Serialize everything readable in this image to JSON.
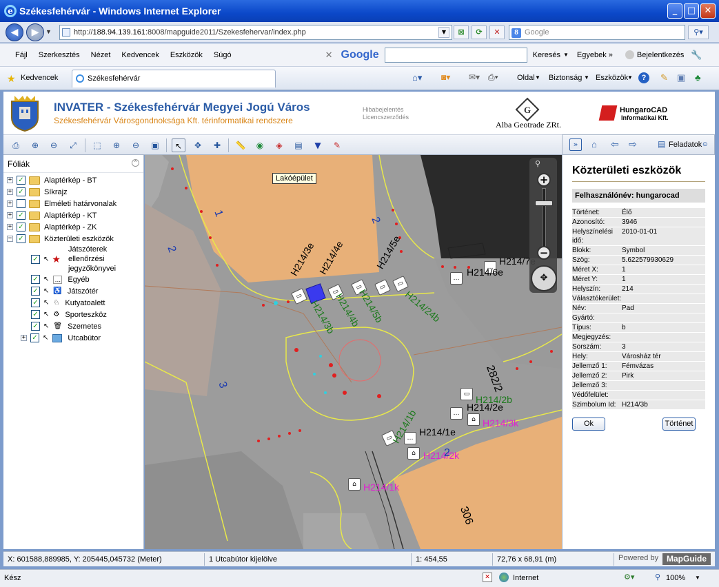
{
  "window": {
    "title": "Székesfehérvár - Windows Internet Explorer",
    "minimize": "_",
    "maximize": "□",
    "close": "✕"
  },
  "address": {
    "url_prefix": "http://",
    "host": "188.94.139.161",
    "url_rest": ":8008/mapguide2011/Szekesfehervar/index.php",
    "search_placeholder": "Google"
  },
  "menubar": {
    "items": [
      "Fájl",
      "Szerkesztés",
      "Nézet",
      "Kedvencek",
      "Eszközök",
      "Súgó"
    ],
    "google_logo": "Google",
    "search_button": "Keresés",
    "more": "Egyebek »",
    "signin": "Bejelentkezés"
  },
  "favbar": {
    "favorites": "Kedvencek",
    "tab_title": "Székesfehérvár",
    "page": "Oldal",
    "security": "Biztonság",
    "tools": "Eszközök"
  },
  "app": {
    "title": "INVATER - Székesfehérvár Megyei Jogú Város",
    "subtitle": "Székesfehérvár Városgondnoksága Kft. térinformatikai rendszere",
    "link1": "Hibabejelentés",
    "link2": "Licencszerződés",
    "partner1": "Alba Geotrade ZRt.",
    "partner2_line1": "HungaroCAD",
    "partner2_line2": "Informatikai Kft."
  },
  "taskbar": {
    "tasks_label": "Feladatok"
  },
  "legend": {
    "title": "Fóliák",
    "layers": [
      {
        "label": "Alaptérkép - BT",
        "checked": true
      },
      {
        "label": "Síkrajz",
        "checked": true
      },
      {
        "label": "Elméleti határvonalak",
        "checked": false
      },
      {
        "label": "Alaptérkép - KT",
        "checked": true
      },
      {
        "label": "Alaptérkép - ZK",
        "checked": true
      },
      {
        "label": "Közterületi eszközök",
        "checked": true
      }
    ],
    "sublayers": [
      {
        "label_line1": "Játszóterek",
        "label_line2": "ellenőrzési",
        "label_line3": "jegyzőkönyvei"
      },
      {
        "label": "Egyéb"
      },
      {
        "label": "Játszótér"
      },
      {
        "label": "Kutyatoalett"
      },
      {
        "label": "Sporteszköz"
      },
      {
        "label": "Szemetes"
      },
      {
        "label": "Utcabútor"
      }
    ]
  },
  "map": {
    "tooltip": "Lakóépület",
    "labels": [
      "H214/3e",
      "H214/4e",
      "H214/5e",
      "H214/6e",
      "H214/7e",
      "H214/3b",
      "H214/4b",
      "H214/5b",
      "H214/24b",
      "H214/1b",
      "H214/1e",
      "H214/2e",
      "H214/2b",
      "H214/3k",
      "H214/2k",
      "H214/1k",
      "282/2",
      "306",
      "1",
      "2",
      "2",
      "2",
      "3"
    ]
  },
  "taskpane": {
    "title": "Közterületi eszközök",
    "user": "Felhasználónév: hungarocad",
    "props": [
      {
        "k": "Történet:",
        "v": "Élő"
      },
      {
        "k": "Azonosító:",
        "v": "3946"
      },
      {
        "k": "Helyszínelési idő:",
        "v": "2010-01-01"
      },
      {
        "k": "Blokk:",
        "v": "Symbol"
      },
      {
        "k": "Szög:",
        "v": "5.622579930629"
      },
      {
        "k": "Méret X:",
        "v": "1"
      },
      {
        "k": "Méret Y:",
        "v": "1"
      },
      {
        "k": "Helyszín:",
        "v": "214"
      },
      {
        "k": "Választókerület:",
        "v": ""
      },
      {
        "k": "Név:",
        "v": "Pad"
      },
      {
        "k": "Gyártó:",
        "v": ""
      },
      {
        "k": "Típus:",
        "v": "b"
      },
      {
        "k": "Megjegyzés:",
        "v": ""
      },
      {
        "k": "Sorszám:",
        "v": "3"
      },
      {
        "k": "Hely:",
        "v": "Városház tér"
      },
      {
        "k": "Jellemző 1:",
        "v": "Fémvázas"
      },
      {
        "k": "Jellemző 2:",
        "v": "Pirk"
      },
      {
        "k": "Jellemző 3:",
        "v": ""
      },
      {
        "k": "Védőfelület:",
        "v": ""
      },
      {
        "k": "Szimbolum Id:",
        "v": "H214/3b"
      }
    ],
    "ok_button": "Ok",
    "history_button": "Történet"
  },
  "status": {
    "coords": "X: 601588,889985, Y: 205445,045732 (Meter)",
    "selection": "1 Utcabútor kijelölve",
    "scale": "1: 454,55",
    "size": "72,76 x 68,91 (m)",
    "powered_by": "Powered by",
    "mapguide": "MapGuide"
  },
  "ie_status": {
    "ready": "Kész",
    "zone": "Internet",
    "zoom": "100%"
  }
}
